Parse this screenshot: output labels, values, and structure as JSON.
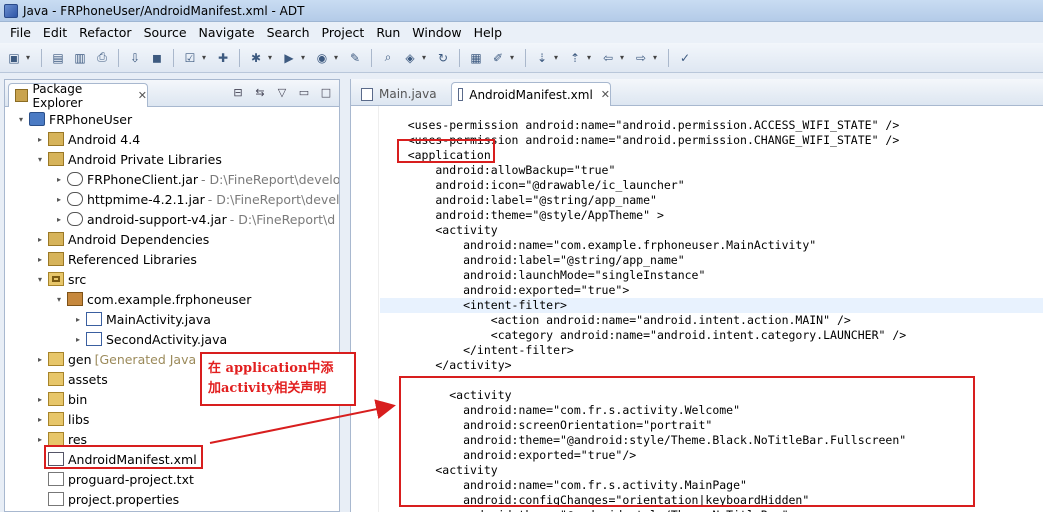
{
  "window": {
    "title": "Java - FRPhoneUser/AndroidManifest.xml - ADT"
  },
  "menu": [
    "File",
    "Edit",
    "Refactor",
    "Source",
    "Navigate",
    "Search",
    "Project",
    "Run",
    "Window",
    "Help"
  ],
  "toolbar": {
    "icons": [
      "new-icon",
      "save-icon",
      "save-all-icon",
      "print-icon",
      "import-icon",
      "android-sdk-icon",
      "checkbox-icon",
      "new-android-project-icon",
      "debug-icon",
      "run-icon",
      "external-tools-icon",
      "open-type-icon",
      "search-icon",
      "new-java-class-icon",
      "refresh-icon",
      "open-task-icon",
      "toggle-mark-icon",
      "annotation-icon",
      "next-annotation-icon",
      "back-icon",
      "forward-icon",
      "pin-icon"
    ]
  },
  "explorer": {
    "title": "Package Explorer",
    "tree": [
      {
        "label": "FRPhoneUser",
        "icon": "project-icon",
        "twisty": "▾",
        "indent": 0
      },
      {
        "label": "Android 4.4",
        "icon": "library-icon",
        "twisty": "▸",
        "indent": 1
      },
      {
        "label": "Android Private Libraries",
        "icon": "library-icon",
        "twisty": "▾",
        "indent": 1
      },
      {
        "label": "FRPhoneClient.jar",
        "path": "- D:\\FineReport\\develo",
        "icon": "jar-icon",
        "twisty": "▸",
        "indent": 2
      },
      {
        "label": "httpmime-4.2.1.jar",
        "path": "- D:\\FineReport\\develc",
        "icon": "jar-icon",
        "twisty": "▸",
        "indent": 2
      },
      {
        "label": "android-support-v4.jar",
        "path": "- D:\\FineReport\\d",
        "icon": "jar-icon",
        "twisty": "▸",
        "indent": 2
      },
      {
        "label": "Android Dependencies",
        "icon": "library-icon",
        "twisty": "▸",
        "indent": 1
      },
      {
        "label": "Referenced Libraries",
        "icon": "library-icon",
        "twisty": "▸",
        "indent": 1
      },
      {
        "label": "src",
        "icon": "source-folder-icon",
        "twisty": "▾",
        "indent": 1
      },
      {
        "label": "com.example.frphoneuser",
        "icon": "package-icon",
        "twisty": "▾",
        "indent": 2
      },
      {
        "label": "MainActivity.java",
        "icon": "java-file-icon",
        "twisty": "▸",
        "indent": 3
      },
      {
        "label": "SecondActivity.java",
        "icon": "java-file-icon",
        "twisty": "▸",
        "indent": 3
      },
      {
        "label": "gen",
        "dim": "[Generated Java",
        "icon": "folder-icon",
        "twisty": "▸",
        "indent": 1
      },
      {
        "label": "assets",
        "icon": "folder-icon",
        "twisty": "",
        "indent": 1
      },
      {
        "label": "bin",
        "icon": "folder-icon",
        "twisty": "▸",
        "indent": 1
      },
      {
        "label": "libs",
        "icon": "folder-icon",
        "twisty": "▸",
        "indent": 1
      },
      {
        "label": "res",
        "icon": "folder-icon",
        "twisty": "▸",
        "indent": 1
      },
      {
        "label": "AndroidManifest.xml",
        "icon": "xml-file-icon",
        "twisty": "",
        "indent": 1
      },
      {
        "label": "proguard-project.txt",
        "icon": "text-file-icon",
        "twisty": "",
        "indent": 1
      },
      {
        "label": "project.properties",
        "icon": "text-file-icon",
        "twisty": "",
        "indent": 1
      }
    ]
  },
  "editor": {
    "tabs": [
      {
        "label": "Main.java",
        "active": false
      },
      {
        "label": "AndroidManifest.xml",
        "active": true
      }
    ],
    "lines": [
      "    <uses-permission android:name=\"android.permission.ACCESS_WIFI_STATE\" />",
      "    <uses-permission android:name=\"android.permission.CHANGE_WIFI_STATE\" />",
      "    <application",
      "        android:allowBackup=\"true\"",
      "        android:icon=\"@drawable/ic_launcher\"",
      "        android:label=\"@string/app_name\"",
      "        android:theme=\"@style/AppTheme\" >",
      "        <activity",
      "            android:name=\"com.example.frphoneuser.MainActivity\"",
      "            android:label=\"@string/app_name\"",
      "            android:launchMode=\"singleInstance\"",
      "            android:exported=\"true\">",
      "            <intent-filter>",
      "                <action android:name=\"android.intent.action.MAIN\" />",
      "                <category android:name=\"android.intent.category.LAUNCHER\" />",
      "            </intent-filter>",
      "        </activity>",
      "",
      "          <activity",
      "            android:name=\"com.fr.s.activity.Welcome\"",
      "            android:screenOrientation=\"portrait\"",
      "            android:theme=\"@android:style/Theme.Black.NoTitleBar.Fullscreen\"",
      "            android:exported=\"true\"/>",
      "        <activity",
      "            android:name=\"com.fr.s.activity.MainPage\"",
      "            android:configChanges=\"orientation|keyboardHidden\"",
      "            android:theme=\"@android:style/Theme.NoTitleBar\""
    ]
  },
  "annotation": {
    "line1": "在 application中添",
    "line2": "加activity相关声明",
    "color": "#d81e1e"
  }
}
